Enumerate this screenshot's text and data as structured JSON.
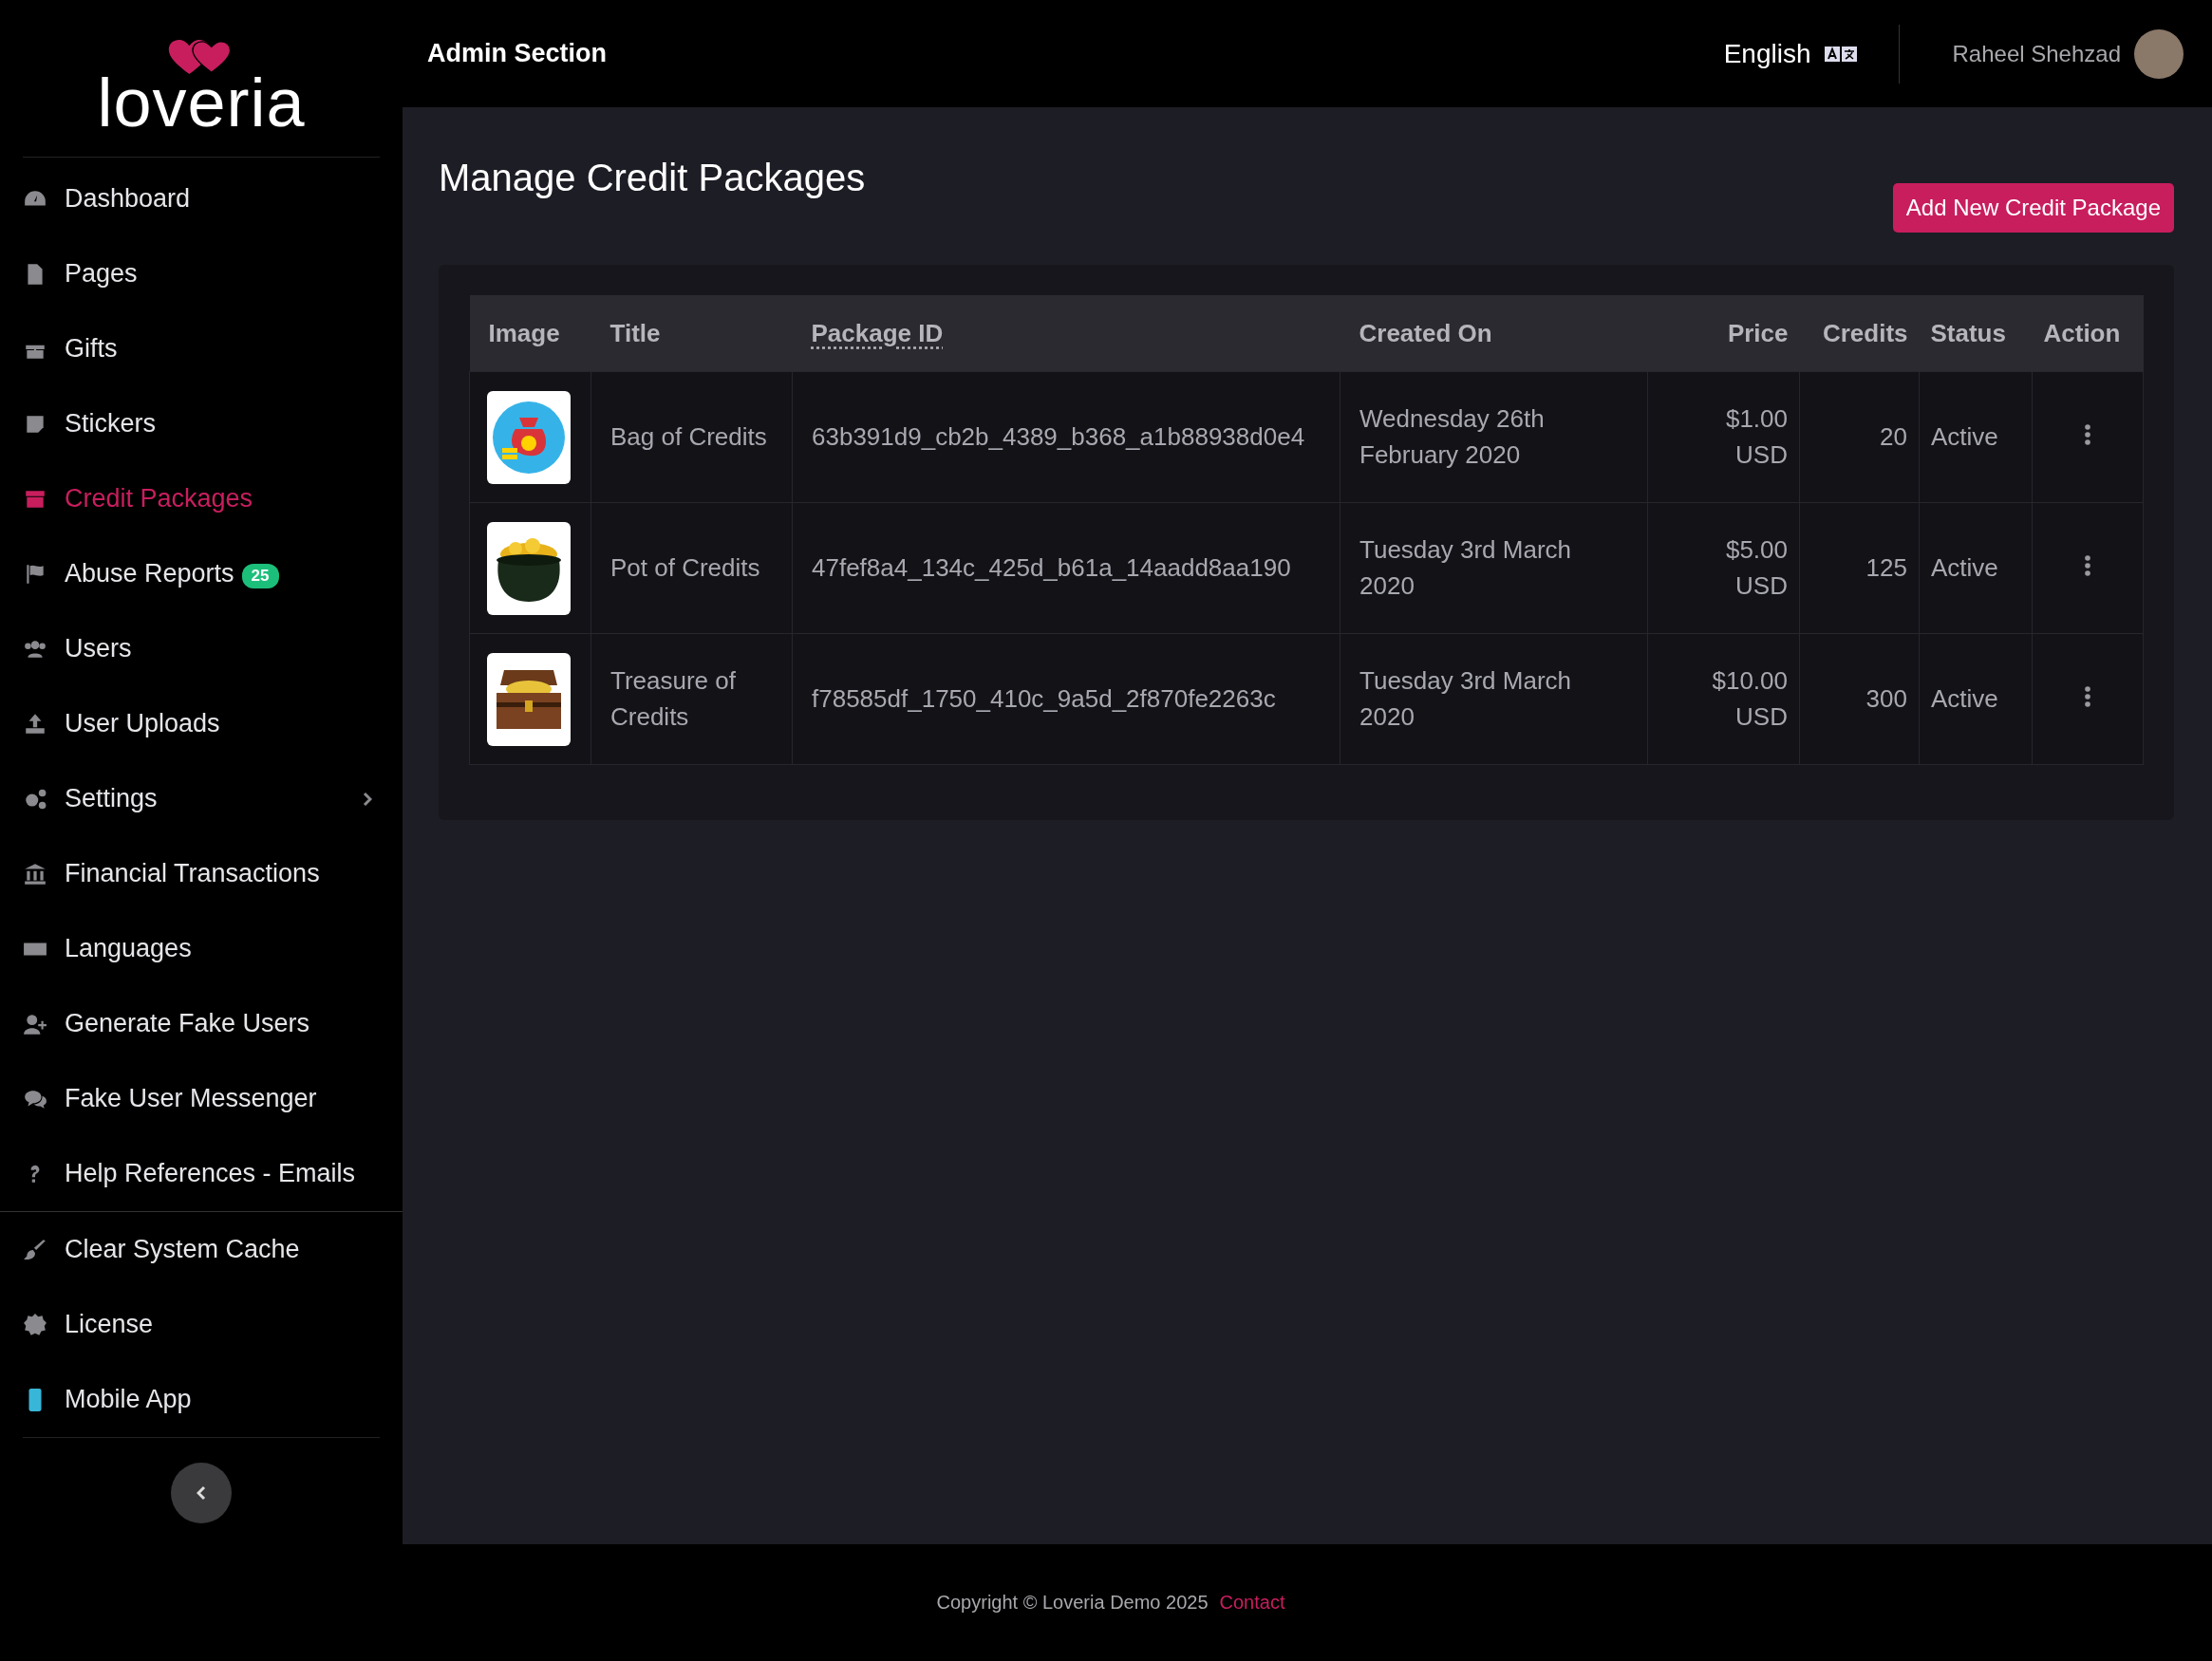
{
  "sidebar": {
    "logo": "loveria",
    "items": [
      {
        "label": "Dashboard",
        "selected": false
      },
      {
        "label": "Pages",
        "selected": false
      },
      {
        "label": "Gifts",
        "selected": false
      },
      {
        "label": "Stickers",
        "selected": false
      },
      {
        "label": "Credit Packages",
        "selected": true
      },
      {
        "label": "Abuse Reports",
        "selected": false,
        "badge": "25"
      },
      {
        "label": "Users",
        "selected": false
      },
      {
        "label": "User Uploads",
        "selected": false
      },
      {
        "label": "Settings",
        "selected": false,
        "expandable": true
      },
      {
        "label": "Financial Transactions",
        "selected": false
      },
      {
        "label": "Languages",
        "selected": false
      },
      {
        "label": "Generate Fake Users",
        "selected": false
      },
      {
        "label": "Fake User Messenger",
        "selected": false
      },
      {
        "label": "Help References - Emails",
        "selected": false
      }
    ],
    "system_items": [
      {
        "label": "Clear System Cache",
        "selected": false
      },
      {
        "label": "License",
        "selected": false
      },
      {
        "label": "Mobile App",
        "selected": false
      }
    ]
  },
  "header": {
    "title": "Admin Section",
    "language": "English",
    "user_name": "Raheel Shehzad"
  },
  "page": {
    "title": "Manage Credit Packages",
    "add_button": "Add New Credit Package"
  },
  "table": {
    "columns": [
      {
        "label": "Image",
        "sortable": false
      },
      {
        "label": "Title",
        "sortable": false
      },
      {
        "label": "Package ID",
        "sortable": true
      },
      {
        "label": "Created On",
        "sortable": false
      },
      {
        "label": "Price",
        "sortable": false
      },
      {
        "label": "Credits",
        "sortable": false
      },
      {
        "label": "Status",
        "sortable": false
      },
      {
        "label": "Action",
        "sortable": false
      }
    ],
    "rows": [
      {
        "title": "Bag of Credits",
        "package_id": "63b391d9_cb2b_4389_b368_a1b88938d0e4",
        "created_on": "Wednesday 26th February 2020",
        "price": "$1.00 USD",
        "credits": "20",
        "status": "Active"
      },
      {
        "title": "Pot of Credits",
        "package_id": "47fef8a4_134c_425d_b61a_14aadd8aa190",
        "created_on": "Tuesday 3rd March 2020",
        "price": "$5.00 USD",
        "credits": "125",
        "status": "Active"
      },
      {
        "title": "Treasure of Credits",
        "package_id": "f78585df_1750_410c_9a5d_2f870fe2263c",
        "created_on": "Tuesday 3rd March 2020",
        "price": "$10.00 USD",
        "credits": "300",
        "status": "Active"
      }
    ]
  },
  "footer": {
    "copyright": "Copyright © Loveria Demo 2025",
    "contact": "Contact"
  }
}
